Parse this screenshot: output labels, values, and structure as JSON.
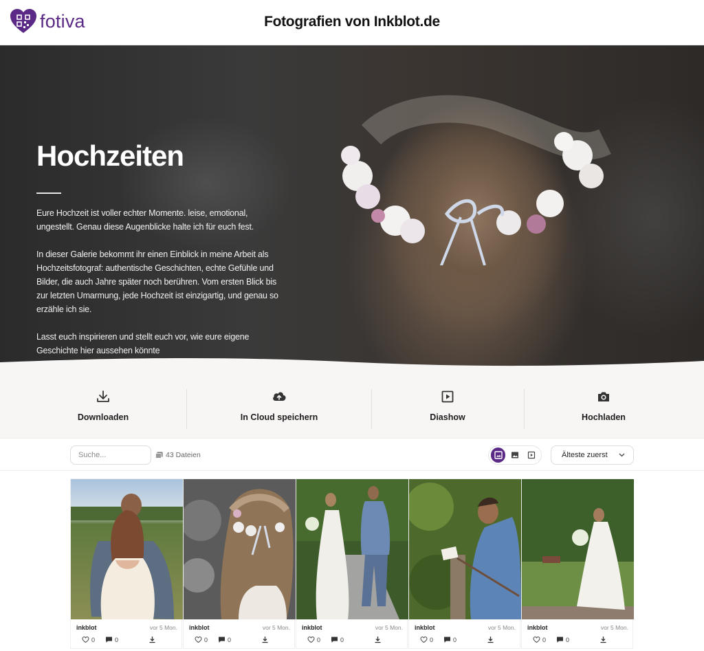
{
  "header": {
    "logo_text": "fotiva",
    "site_title": "Fotografien von Inkblot.de",
    "brand_color": "#5b2a86"
  },
  "hero": {
    "title": "Hochzeiten",
    "paragraphs": [
      "Eure Hochzeit ist voller echter Momente. leise, emotional, ungestellt. Genau diese Augenblicke halte ich für euch fest.",
      "In dieser Galerie bekommt ihr einen Einblick in meine Arbeit als Hochzeitsfotograf: authentische Geschichten, echte Gefühle und Bilder, die auch Jahre später noch berühren. Vom ersten Blick bis zur letzten Umarmung, jede Hochzeit ist einzigartig, und genau so erzähle ich sie.",
      "Lasst euch inspirieren und stellt euch vor, wie eure eigene Geschichte hier aussehen könnte"
    ]
  },
  "actions": [
    {
      "label": "Downloaden",
      "icon": "download-icon"
    },
    {
      "label": "In Cloud speichern",
      "icon": "cloud-upload-icon"
    },
    {
      "label": "Diashow",
      "icon": "play-square-icon"
    },
    {
      "label": "Hochladen",
      "icon": "camera-icon"
    }
  ],
  "toolbar": {
    "search_placeholder": "Suche...",
    "file_count": "43 Dateien",
    "view_modes": [
      "gallery-icon",
      "image-icon",
      "video-icon"
    ],
    "sort_value": "Älteste zuerst"
  },
  "gallery": {
    "items": [
      {
        "author": "inkblot",
        "age": "vor 5 Mon.",
        "likes": "0",
        "comments": "0"
      },
      {
        "author": "inkblot",
        "age": "vor 5 Mon.",
        "likes": "0",
        "comments": "0"
      },
      {
        "author": "inkblot",
        "age": "vor 5 Mon.",
        "likes": "0",
        "comments": "0"
      },
      {
        "author": "inkblot",
        "age": "vor 5 Mon.",
        "likes": "0",
        "comments": "0"
      },
      {
        "author": "inkblot",
        "age": "vor 5 Mon.",
        "likes": "0",
        "comments": "0"
      }
    ]
  }
}
